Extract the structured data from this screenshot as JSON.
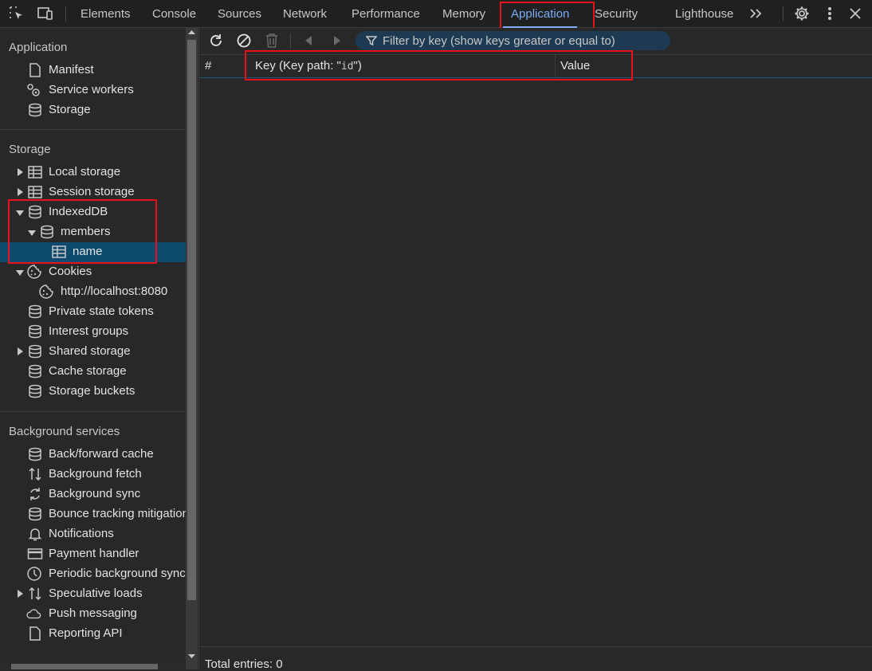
{
  "tabs": [
    {
      "label": "Elements"
    },
    {
      "label": "Console"
    },
    {
      "label": "Sources"
    },
    {
      "label": "Network"
    },
    {
      "label": "Performance"
    },
    {
      "label": "Memory"
    },
    {
      "label": "Application"
    },
    {
      "label": "Security"
    },
    {
      "label": "Lighthouse"
    }
  ],
  "active_tab": "Application",
  "sidebar": {
    "application_title": "Application",
    "application_items": [
      {
        "label": "Manifest",
        "icon": "document-icon"
      },
      {
        "label": "Service workers",
        "icon": "gears-icon"
      },
      {
        "label": "Storage",
        "icon": "database-icon"
      }
    ],
    "storage_title": "Storage",
    "storage_items": [
      {
        "label": "Local storage",
        "icon": "table-icon"
      },
      {
        "label": "Session storage",
        "icon": "table-icon"
      },
      {
        "label": "IndexedDB",
        "icon": "database-icon"
      },
      {
        "label": "members",
        "icon": "database-icon"
      },
      {
        "label": "name",
        "icon": "table-icon"
      },
      {
        "label": "Cookies",
        "icon": "cookie-icon"
      },
      {
        "label": "http://localhost:8080",
        "icon": "cookie-icon"
      },
      {
        "label": "Private state tokens",
        "icon": "database-icon"
      },
      {
        "label": "Interest groups",
        "icon": "database-icon"
      },
      {
        "label": "Shared storage",
        "icon": "database-icon"
      },
      {
        "label": "Cache storage",
        "icon": "database-icon"
      },
      {
        "label": "Storage buckets",
        "icon": "database-icon"
      }
    ],
    "background_title": "Background services",
    "background_items": [
      {
        "label": "Back/forward cache",
        "icon": "database-icon"
      },
      {
        "label": "Background fetch",
        "icon": "arrows-updown-icon"
      },
      {
        "label": "Background sync",
        "icon": "sync-icon"
      },
      {
        "label": "Bounce tracking mitigations",
        "icon": "database-icon"
      },
      {
        "label": "Notifications",
        "icon": "bell-icon"
      },
      {
        "label": "Payment handler",
        "icon": "card-icon"
      },
      {
        "label": "Periodic background sync",
        "icon": "clock-icon"
      },
      {
        "label": "Speculative loads",
        "icon": "arrows-updown-icon"
      },
      {
        "label": "Push messaging",
        "icon": "cloud-icon"
      },
      {
        "label": "Reporting API",
        "icon": "document-icon"
      }
    ]
  },
  "main": {
    "filter_placeholder": "Filter by key (show keys greater or equal to)",
    "columns": {
      "index": "#",
      "key_prefix": "Key (Key path: \"",
      "key_path": "id",
      "key_suffix": "\")",
      "value": "Value"
    },
    "footer": "Total entries: 0"
  },
  "colors": {
    "accent": "#7cacf8",
    "highlight_box": "#e8121c",
    "selected_row": "#0d4a6e"
  }
}
